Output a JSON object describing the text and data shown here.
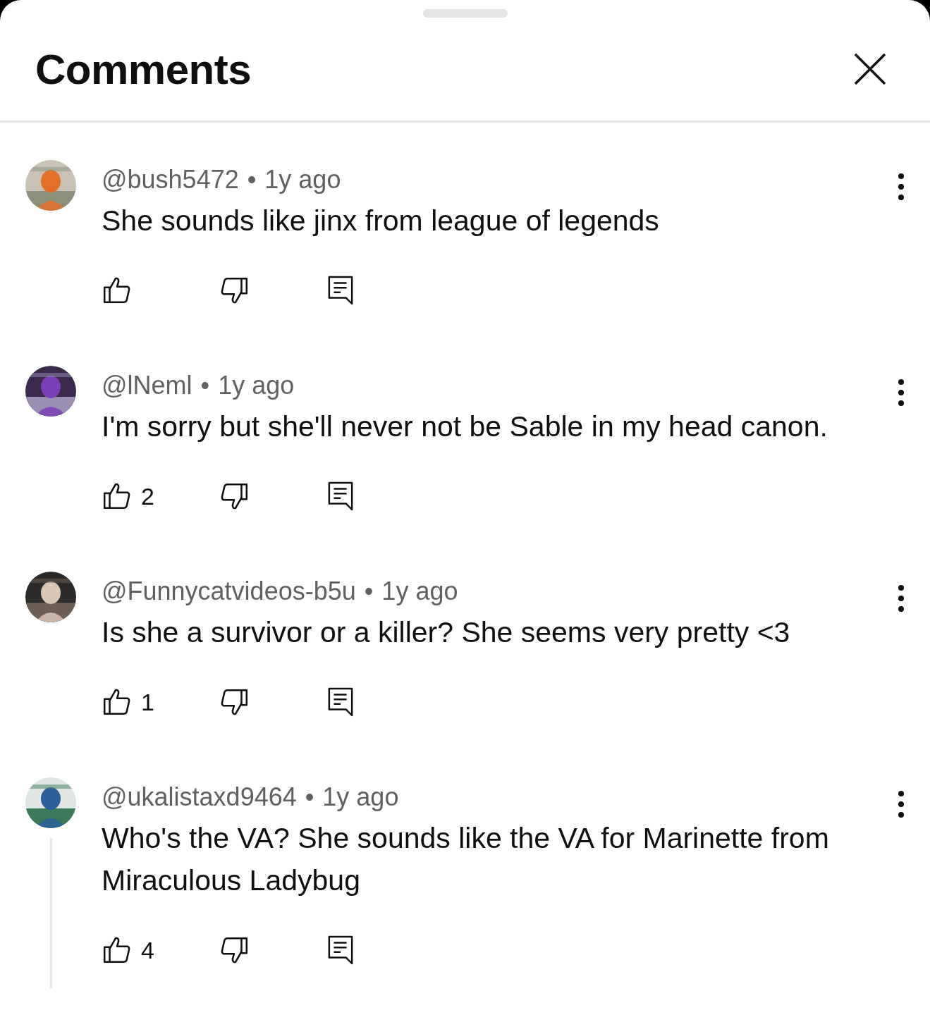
{
  "sheet": {
    "title": "Comments"
  },
  "comments": [
    {
      "handle": "@bush5472",
      "separator": "•",
      "time": "1y ago",
      "text": "She sounds like jinx from league of legends",
      "has_replies": false
    },
    {
      "handle": "@lNeml",
      "separator": "•",
      "time": "1y ago",
      "text": "I'm sorry but she'll never not be Sable in my head canon.",
      "likes": "2",
      "has_replies": false
    },
    {
      "handle": "@Funnycatvideos-b5u",
      "separator": "•",
      "time": "1y ago",
      "text": "Is she a survivor or a killer? She seems very pretty <3",
      "likes": "1",
      "has_replies": false
    },
    {
      "handle": "@ukalistaxd9464",
      "separator": "•",
      "time": "1y ago",
      "text": "Who's the VA? She sounds like the VA for Marinette from Miraculous Ladybug",
      "likes": "4",
      "has_replies": true
    }
  ]
}
